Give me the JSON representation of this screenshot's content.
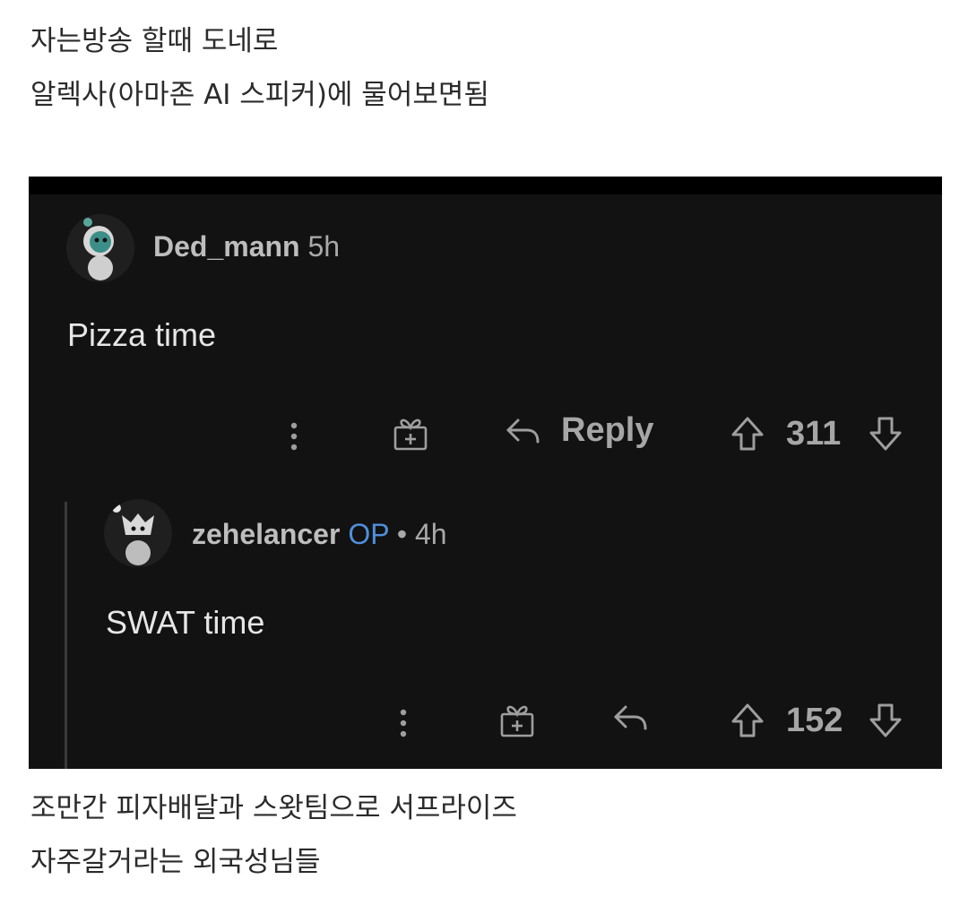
{
  "captions": {
    "top": [
      "자는방송 할때 도네로",
      "알렉사(아마존 AI 스피커)에 물어보면됨"
    ],
    "bottom": [
      "조만간 피자배달과 스왓팀으로 서프라이즈",
      "자주갈거라는 외국성님들"
    ]
  },
  "comments": [
    {
      "username": "Ded_mann",
      "time": "5h",
      "text": "Pizza time",
      "reply_label": "Reply",
      "score": "311"
    },
    {
      "username": "zehelancer",
      "op_badge": "OP",
      "separator": "•",
      "time": "4h",
      "text": "SWAT time",
      "score": "152"
    }
  ],
  "colors": {
    "background": "#121212",
    "op": "#4f8fdc",
    "text": "#e6e6e6"
  },
  "icons": [
    "more-icon",
    "gift-icon",
    "reply-icon",
    "upvote-icon",
    "downvote-icon",
    "avatar"
  ]
}
